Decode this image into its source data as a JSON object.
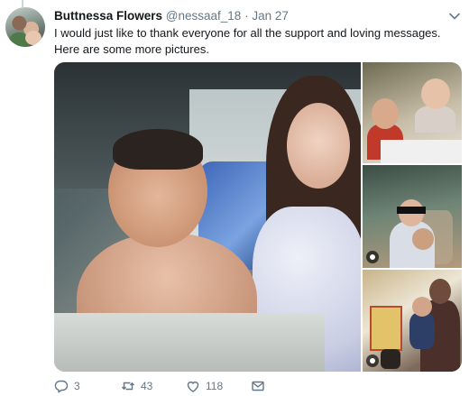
{
  "tweet": {
    "author_name": "Buttnessa Flowers",
    "handle": "@nessaaf_18",
    "separator": "·",
    "date": "Jan 27",
    "text": "I would just like to thank everyone for all the support and loving messages. Here are some more pictures."
  },
  "icons": {
    "more": "chevron-down-icon",
    "reply": "reply-icon",
    "retweet": "retweet-icon",
    "like": "heart-icon",
    "dm": "envelope-icon"
  },
  "actions": {
    "reply_count": "3",
    "retweet_count": "43",
    "like_count": "118"
  },
  "colors": {
    "text_primary": "#14171a",
    "text_secondary": "#657786",
    "divider": "#ccd6dd"
  }
}
